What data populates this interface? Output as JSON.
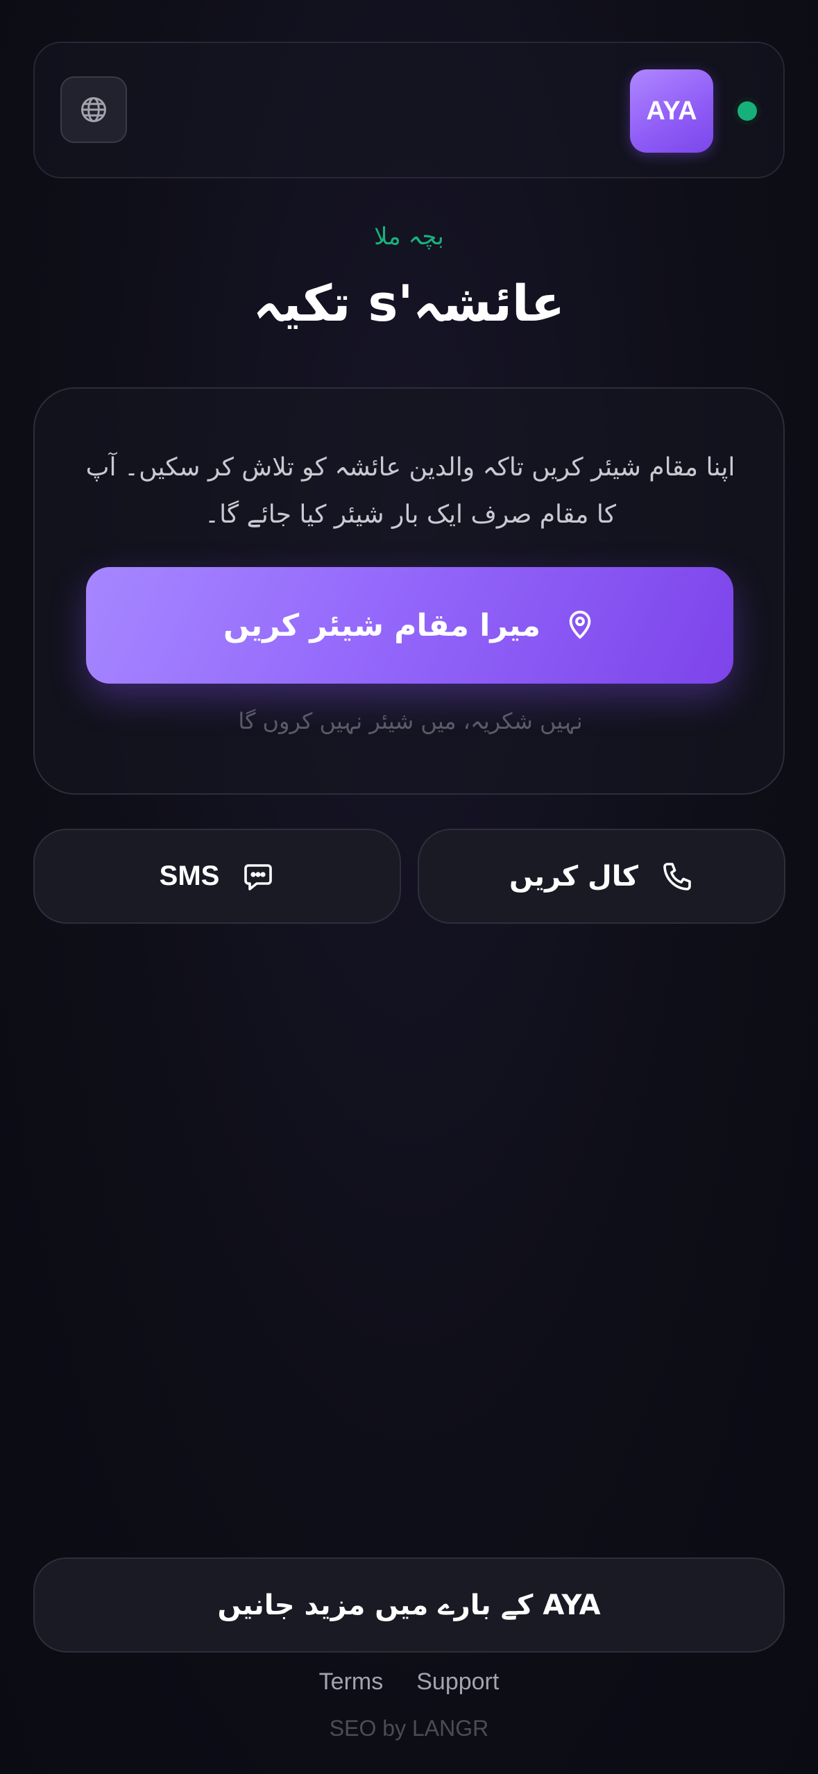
{
  "header": {
    "logo_text": "AYA",
    "globe_icon": "globe-icon",
    "status_color": "#17b07a"
  },
  "main": {
    "kicker": "بچہ ملا",
    "title": "عائشہ's تکیہ"
  },
  "card": {
    "description": "اپنا مقام شیئر کریں تاکہ والدین عائشہ کو تلاش کر سکیں۔ آپ کا مقام صرف ایک بار شیئر کیا جائے گا۔",
    "share_label": "میرا مقام شیئر کریں",
    "share_icon": "location-pin-icon",
    "decline_label": "نہیں شکریہ، میں شیئر نہیں کروں گا"
  },
  "actions": {
    "sms_label": "SMS",
    "sms_icon": "chat-bubble-icon",
    "call_label": "کال کریں",
    "call_icon": "phone-icon"
  },
  "footer": {
    "learn_more_label": "AYA کے بارے میں مزید جانیں",
    "terms_label": "Terms",
    "support_label": "Support",
    "powered_label": "SEO by LANGR"
  },
  "colors": {
    "accent": "#9468fb",
    "accent_dark": "#7d44ea",
    "success": "#19b27a",
    "background": "#0e0e18"
  }
}
